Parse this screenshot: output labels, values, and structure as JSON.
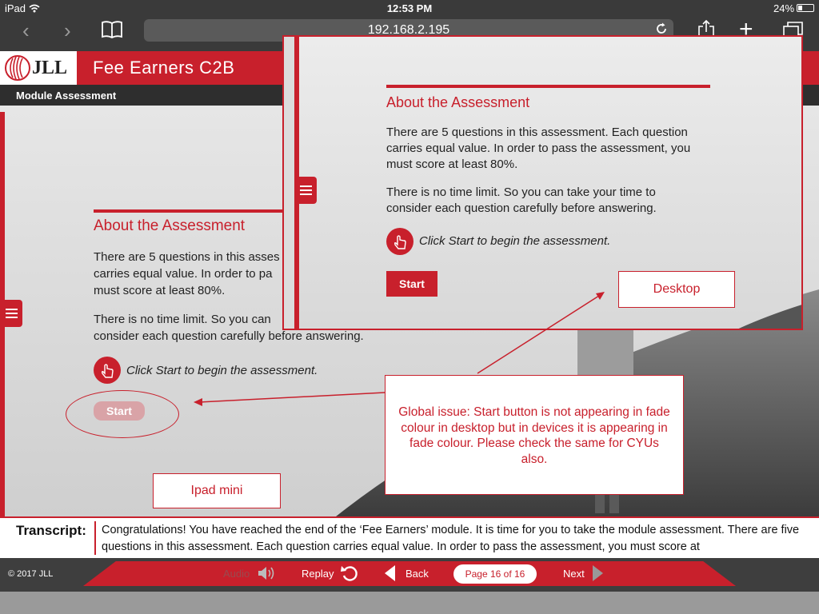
{
  "status_bar": {
    "device": "iPad",
    "time": "12:53 PM",
    "battery": "24%"
  },
  "browser": {
    "address": "192.168.2.195"
  },
  "course": {
    "logo_text": "JLL",
    "title": "Fee Earners C2B",
    "module_label": "Module Assessment"
  },
  "assessment": {
    "heading": "About the Assessment",
    "para1_line1": "There are 5 questions in this asses",
    "para1_line2": "carries equal value. In order to pa",
    "para1_line3": "must score at least 80%.",
    "para2_line1": "There is no time limit. So you can",
    "para2_line2": "consider each question carefully before answering.",
    "hint": "Click Start to begin the assessment.",
    "start_label": "Start"
  },
  "desktop_overlay": {
    "heading": "About the Assessment",
    "para1_line1": "There are 5 questions in this assessment. Each question",
    "para1_line2": "carries equal value. In order to pass the assessment, you",
    "para1_line3": "must score at least 80%.",
    "para2_line1": "There is no time limit. So you can take your time to",
    "para2_line2": "consider each question carefully before answering.",
    "hint": "Click Start to begin the assessment.",
    "start_label": "Start"
  },
  "annotations": {
    "desktop_label": "Desktop",
    "ipad_label": "Ipad mini",
    "issue_text": "Global issue: Start button is not appearing in fade colour in desktop but in devices it is appearing in fade colour. Please check the same for CYUs also."
  },
  "transcript": {
    "label": "Transcript:",
    "text": "Congratulations! You have reached the end of the ‘Fee Earners’ module. It is time for you to take the module assessment. There are five questions in this assessment. Each question carries equal value. In order to pass the assessment, you must score at"
  },
  "footer": {
    "copyright": "© 2017 JLL",
    "audio_label": "Audio",
    "replay_label": "Replay",
    "back_label": "Back",
    "page_indicator": "Page 16 of 16",
    "next_label": "Next"
  },
  "colors": {
    "brand_red": "#c8202c",
    "dark_bar": "#2e2e2e",
    "faded_button": "#d9a3a7"
  },
  "icons": [
    "wifi-icon",
    "bookmarks-icon",
    "reload-icon",
    "share-icon",
    "new-tab-icon",
    "tabs-icon",
    "menu-icon",
    "pointer-hand-icon",
    "speaker-icon",
    "replay-icon",
    "back-arrow-icon",
    "next-arrow-icon"
  ]
}
